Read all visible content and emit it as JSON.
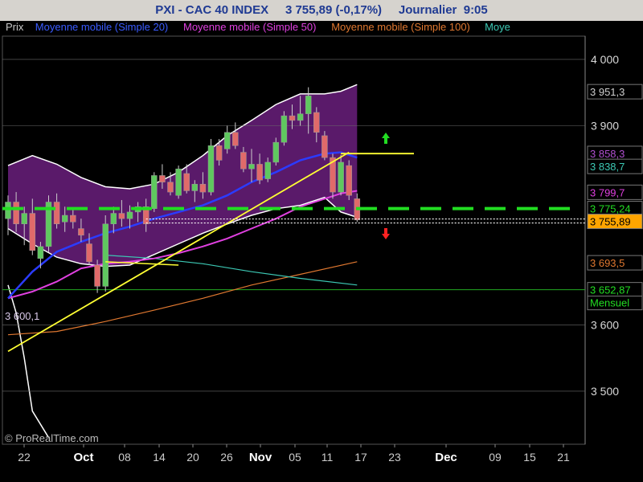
{
  "header": {
    "title": "PXI - CAC 40 INDEX     3 755,89 (-0,17%)     Journalier  9:05"
  },
  "legend": [
    {
      "label": "Prix",
      "color": "#c8c8c8"
    },
    {
      "label": "Moyenne mobile (Simple 20)",
      "color": "#3a5bff"
    },
    {
      "label": "Moyenne mobile (Simple 50)",
      "color": "#e040e0"
    },
    {
      "label": "Moyenne mobile (Simple 100)",
      "color": "#e07830"
    },
    {
      "label": "Moye",
      "color": "#3cc8b4"
    }
  ],
  "watermark": "© ProRealTime.com",
  "colors": {
    "up": "#5fc85f",
    "down": "#e06a6a",
    "band_fill": "#5a1a6a",
    "trend": "#ffff33",
    "support": "#22dd22"
  },
  "chart_data": {
    "type": "candlestick",
    "ylim": [
      3420,
      4035
    ],
    "y_ticks": [
      {
        "value": 4000,
        "label": "4 000"
      },
      {
        "value": 3900,
        "label": "3 900"
      },
      {
        "value": 3600,
        "label": "3 600"
      },
      {
        "value": 3500,
        "label": "3 500"
      }
    ],
    "x_labels": [
      "22",
      "Oct",
      "08",
      "14",
      "20",
      "26",
      "Nov",
      "05",
      "11",
      "17",
      "23",
      "Dec",
      "09",
      "15",
      "21"
    ],
    "bold_x_labels": [
      "Oct",
      "Nov",
      "Dec"
    ],
    "price_tags": [
      {
        "value": 3951.3,
        "label": "3 951,3",
        "color": "#d0d0d0",
        "bg": "#000000"
      },
      {
        "value": 3858.3,
        "label": "3 858,3",
        "color": "#b050d0",
        "bg": "#000000"
      },
      {
        "value": 3838.7,
        "label": "3 838,7",
        "color": "#3cc8b4",
        "bg": "#000000"
      },
      {
        "value": 3799.7,
        "label": "3 799,7",
        "color": "#e040e0",
        "bg": "#000000"
      },
      {
        "value": 3775.24,
        "label": "3 775,24",
        "color": "#22dd22",
        "bg": "#000000"
      },
      {
        "value": 3755.89,
        "label": "3 755,89",
        "color": "#000000",
        "bg": "#ffa500"
      },
      {
        "value": 3693.5,
        "label": "3 693,5",
        "color": "#e07830",
        "bg": "#000000"
      },
      {
        "value": 3652.87,
        "label": "3 652,87",
        "color": "#22dd22",
        "bg": "#000000"
      }
    ],
    "mensuel_label": "Mensuel",
    "low_label": "3 600,1",
    "candles": [
      {
        "o": 3760,
        "h": 3795,
        "l": 3735,
        "c": 3785
      },
      {
        "o": 3785,
        "h": 3800,
        "l": 3740,
        "c": 3752
      },
      {
        "o": 3752,
        "h": 3778,
        "l": 3720,
        "c": 3768
      },
      {
        "o": 3768,
        "h": 3790,
        "l": 3705,
        "c": 3712
      },
      {
        "o": 3700,
        "h": 3725,
        "l": 3685,
        "c": 3718
      },
      {
        "o": 3718,
        "h": 3795,
        "l": 3710,
        "c": 3785
      },
      {
        "o": 3785,
        "h": 3798,
        "l": 3745,
        "c": 3752
      },
      {
        "o": 3755,
        "h": 3778,
        "l": 3740,
        "c": 3765
      },
      {
        "o": 3765,
        "h": 3775,
        "l": 3745,
        "c": 3755
      },
      {
        "o": 3745,
        "h": 3760,
        "l": 3725,
        "c": 3735
      },
      {
        "o": 3722,
        "h": 3738,
        "l": 3690,
        "c": 3695
      },
      {
        "o": 3690,
        "h": 3698,
        "l": 3648,
        "c": 3658
      },
      {
        "o": 3658,
        "h": 3765,
        "l": 3650,
        "c": 3752
      },
      {
        "o": 3752,
        "h": 3778,
        "l": 3738,
        "c": 3768
      },
      {
        "o": 3768,
        "h": 3788,
        "l": 3748,
        "c": 3760
      },
      {
        "o": 3760,
        "h": 3780,
        "l": 3745,
        "c": 3770
      },
      {
        "o": 3770,
        "h": 3785,
        "l": 3755,
        "c": 3778
      },
      {
        "o": 3778,
        "h": 3790,
        "l": 3740,
        "c": 3752
      },
      {
        "o": 3775,
        "h": 3830,
        "l": 3770,
        "c": 3825
      },
      {
        "o": 3825,
        "h": 3842,
        "l": 3805,
        "c": 3815
      },
      {
        "o": 3815,
        "h": 3830,
        "l": 3795,
        "c": 3800
      },
      {
        "o": 3795,
        "h": 3840,
        "l": 3790,
        "c": 3835
      },
      {
        "o": 3828,
        "h": 3842,
        "l": 3798,
        "c": 3802
      },
      {
        "o": 3802,
        "h": 3818,
        "l": 3785,
        "c": 3812
      },
      {
        "o": 3812,
        "h": 3830,
        "l": 3790,
        "c": 3800
      },
      {
        "o": 3800,
        "h": 3880,
        "l": 3795,
        "c": 3870
      },
      {
        "o": 3870,
        "h": 3880,
        "l": 3840,
        "c": 3848
      },
      {
        "o": 3865,
        "h": 3900,
        "l": 3858,
        "c": 3890
      },
      {
        "o": 3890,
        "h": 3905,
        "l": 3865,
        "c": 3870
      },
      {
        "o": 3860,
        "h": 3868,
        "l": 3830,
        "c": 3835
      },
      {
        "o": 3835,
        "h": 3865,
        "l": 3815,
        "c": 3842
      },
      {
        "o": 3842,
        "h": 3858,
        "l": 3812,
        "c": 3818
      },
      {
        "o": 3820,
        "h": 3852,
        "l": 3815,
        "c": 3845
      },
      {
        "o": 3845,
        "h": 3882,
        "l": 3840,
        "c": 3875
      },
      {
        "o": 3875,
        "h": 3922,
        "l": 3870,
        "c": 3915
      },
      {
        "o": 3915,
        "h": 3932,
        "l": 3895,
        "c": 3908
      },
      {
        "o": 3908,
        "h": 3945,
        "l": 3900,
        "c": 3918
      },
      {
        "o": 3918,
        "h": 3958,
        "l": 3888,
        "c": 3945
      },
      {
        "o": 3920,
        "h": 3928,
        "l": 3875,
        "c": 3890
      },
      {
        "o": 3885,
        "h": 3892,
        "l": 3848,
        "c": 3852
      },
      {
        "o": 3852,
        "h": 3858,
        "l": 3790,
        "c": 3800
      },
      {
        "o": 3800,
        "h": 3856,
        "l": 3795,
        "c": 3845
      },
      {
        "o": 3840,
        "h": 3848,
        "l": 3788,
        "c": 3795
      },
      {
        "o": 3790,
        "h": 3798,
        "l": 3755,
        "c": 3758
      }
    ],
    "bands": {
      "upper": [
        [
          0,
          3840
        ],
        [
          3,
          3855
        ],
        [
          6,
          3842
        ],
        [
          9,
          3822
        ],
        [
          12,
          3808
        ],
        [
          15,
          3805
        ],
        [
          18,
          3812
        ],
        [
          21,
          3830
        ],
        [
          24,
          3855
        ],
        [
          27,
          3885
        ],
        [
          30,
          3908
        ],
        [
          33,
          3932
        ],
        [
          36,
          3948
        ],
        [
          39,
          3948
        ],
        [
          41,
          3952
        ],
        [
          43,
          3962
        ]
      ],
      "lower": [
        [
          0,
          3660
        ],
        [
          1,
          3618
        ],
        [
          2,
          3550
        ],
        [
          3,
          3470
        ],
        [
          5,
          3430
        ]
      ],
      "lower2": [
        [
          0,
          3745
        ],
        [
          3,
          3722
        ],
        [
          6,
          3702
        ],
        [
          9,
          3692
        ],
        [
          12,
          3688
        ],
        [
          15,
          3690
        ],
        [
          18,
          3706
        ],
        [
          21,
          3722
        ],
        [
          24,
          3738
        ],
        [
          27,
          3752
        ],
        [
          30,
          3765
        ],
        [
          33,
          3775
        ],
        [
          36,
          3780
        ],
        [
          39,
          3792
        ],
        [
          41,
          3770
        ],
        [
          43,
          3762
        ]
      ]
    },
    "ma20": [
      [
        0,
        3640
      ],
      [
        3,
        3680
      ],
      [
        6,
        3710
      ],
      [
        9,
        3725
      ],
      [
        12,
        3738
      ],
      [
        15,
        3748
      ],
      [
        18,
        3760
      ],
      [
        21,
        3770
      ],
      [
        24,
        3780
      ],
      [
        27,
        3795
      ],
      [
        30,
        3815
      ],
      [
        33,
        3830
      ],
      [
        36,
        3848
      ],
      [
        39,
        3858
      ],
      [
        41,
        3860
      ],
      [
        43,
        3852
      ]
    ],
    "ma50": [
      [
        0,
        3640
      ],
      [
        3,
        3650
      ],
      [
        6,
        3665
      ],
      [
        9,
        3685
      ],
      [
        12,
        3692
      ],
      [
        15,
        3695
      ],
      [
        18,
        3700
      ],
      [
        21,
        3708
      ],
      [
        24,
        3718
      ],
      [
        27,
        3730
      ],
      [
        30,
        3745
      ],
      [
        33,
        3760
      ],
      [
        36,
        3778
      ],
      [
        39,
        3790
      ],
      [
        41,
        3798
      ],
      [
        43,
        3802
      ]
    ],
    "ma100": [
      [
        0,
        3585
      ],
      [
        6,
        3590
      ],
      [
        12,
        3605
      ],
      [
        18,
        3622
      ],
      [
        24,
        3640
      ],
      [
        30,
        3660
      ],
      [
        36,
        3676
      ],
      [
        43,
        3695
      ]
    ],
    "ma_teal": [
      [
        12,
        3705
      ],
      [
        18,
        3700
      ],
      [
        24,
        3692
      ],
      [
        30,
        3680
      ],
      [
        36,
        3670
      ],
      [
        43,
        3660
      ]
    ],
    "trendline": [
      [
        0,
        3560
      ],
      [
        42,
        3860
      ]
    ],
    "trend_flat": [
      [
        41,
        3858
      ],
      [
        50,
        3858
      ]
    ],
    "support_level": 3775.24,
    "current_price": 3755.89,
    "monthly_level": 3652.87
  }
}
